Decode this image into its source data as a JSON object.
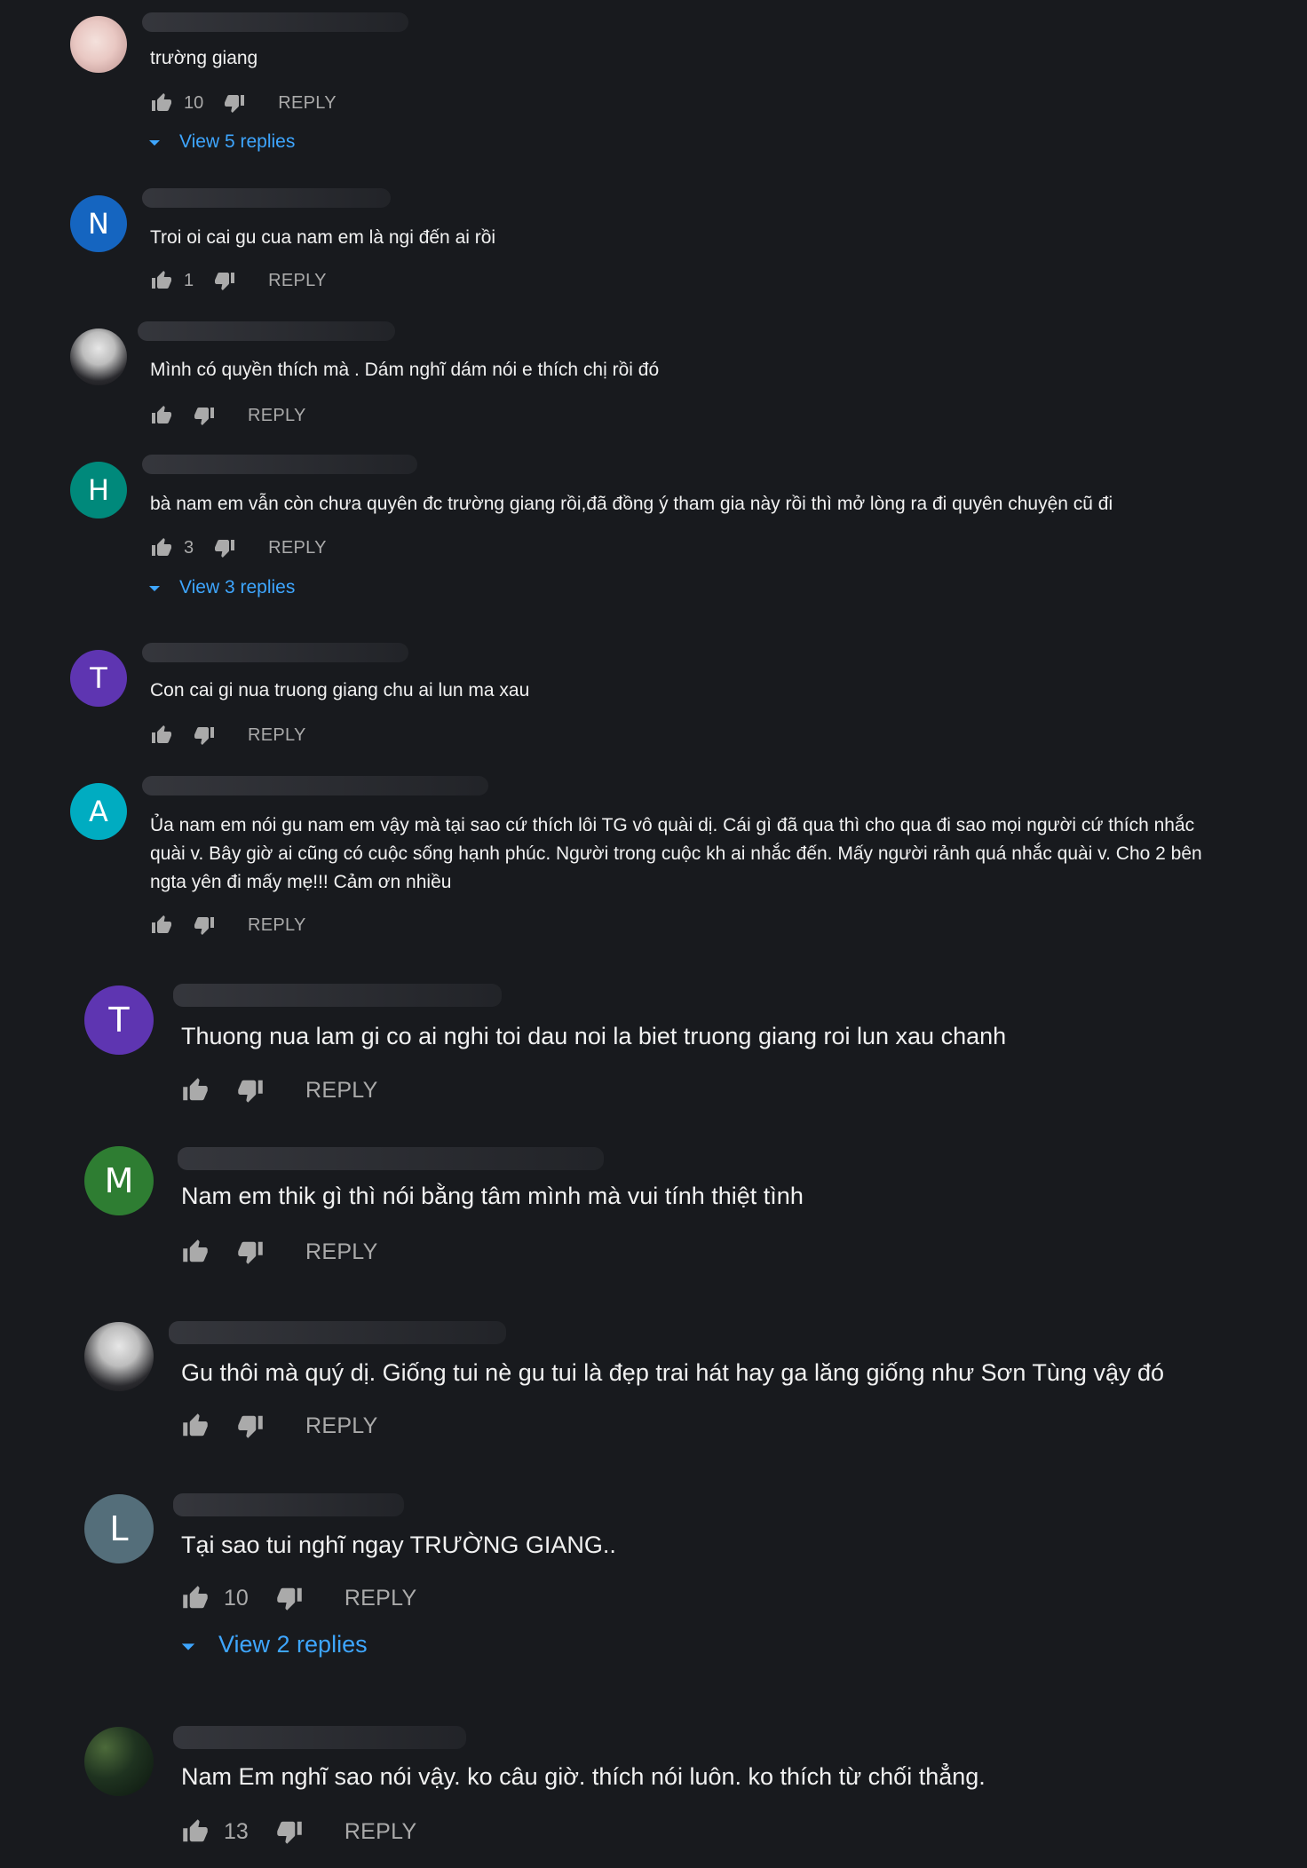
{
  "labels": {
    "reply": "REPLY"
  },
  "comments": [
    {
      "avatar_type": "photo",
      "avatar_letter": "",
      "avatar_color": "",
      "text": "trường giang",
      "likes": "10",
      "view_replies": "View 5 replies"
    },
    {
      "avatar_type": "letter",
      "avatar_letter": "N",
      "avatar_color": "#1565c0",
      "text": "Troi oi cai gu cua nam em là ngi đến ai rồi",
      "likes": "1",
      "view_replies": ""
    },
    {
      "avatar_type": "photo",
      "avatar_letter": "",
      "avatar_color": "",
      "text": "Mình có quyền thích mà . Dám nghĩ dám nói e thích chị rồi đó",
      "likes": "",
      "view_replies": ""
    },
    {
      "avatar_type": "letter",
      "avatar_letter": "H",
      "avatar_color": "#00897b",
      "text": "bà nam em vẫn còn chưa quyên đc trường giang rồi,đã đồng ý tham gia này rồi thì mở lòng ra đi quyên chuyện cũ đi",
      "likes": "3",
      "view_replies": "View 3 replies"
    },
    {
      "avatar_type": "letter",
      "avatar_letter": "T",
      "avatar_color": "#5e35b1",
      "text": "Con cai gi nua truong giang chu ai lun ma xau",
      "likes": "",
      "view_replies": ""
    },
    {
      "avatar_type": "letter",
      "avatar_letter": "A",
      "avatar_color": "#00acc1",
      "text": "Ủa nam em nói gu nam em vậy mà tại sao cứ thích lôi TG vô quài dị. Cái gì đã qua thì cho qua đi sao mọi người cứ thích nhắc quài v. Bây giờ ai cũng có cuộc sống hạnh phúc. Người trong cuộc kh ai nhắc đến. Mấy người rảnh quá nhắc quài v. Cho 2 bên ngta yên đi mấy mẹ!!! Cảm ơn nhiều",
      "likes": "",
      "view_replies": ""
    },
    {
      "avatar_type": "letter",
      "avatar_letter": "T",
      "avatar_color": "#5e35b1",
      "text": "Thuong nua lam gi co ai nghi toi dau noi la biet truong giang roi lun xau chanh",
      "likes": "",
      "view_replies": ""
    },
    {
      "avatar_type": "letter",
      "avatar_letter": "M",
      "avatar_color": "#2e7d32",
      "text": "Nam em thik gì thì nói bằng tâm mình mà vui tính thiệt tình",
      "likes": "",
      "view_replies": ""
    },
    {
      "avatar_type": "photo",
      "avatar_letter": "",
      "avatar_color": "",
      "text": "Gu thôi mà quý dị. Giống tui nè gu tui là đẹp trai hát hay ga lăng giống như Sơn Tùng vậy đó",
      "likes": "",
      "view_replies": ""
    },
    {
      "avatar_type": "letter",
      "avatar_letter": "L",
      "avatar_color": "#546e7a",
      "text": "Tại sao tui nghĩ ngay TRƯỜNG GIANG..",
      "likes": "10",
      "view_replies": "View 2 replies"
    },
    {
      "avatar_type": "photo",
      "avatar_letter": "",
      "avatar_color": "",
      "text": "Nam Em nghĩ sao nói vậy. ko câu giờ. thích nói luôn. ko thích từ chối thẳng.",
      "likes": "13",
      "view_replies": ""
    }
  ]
}
